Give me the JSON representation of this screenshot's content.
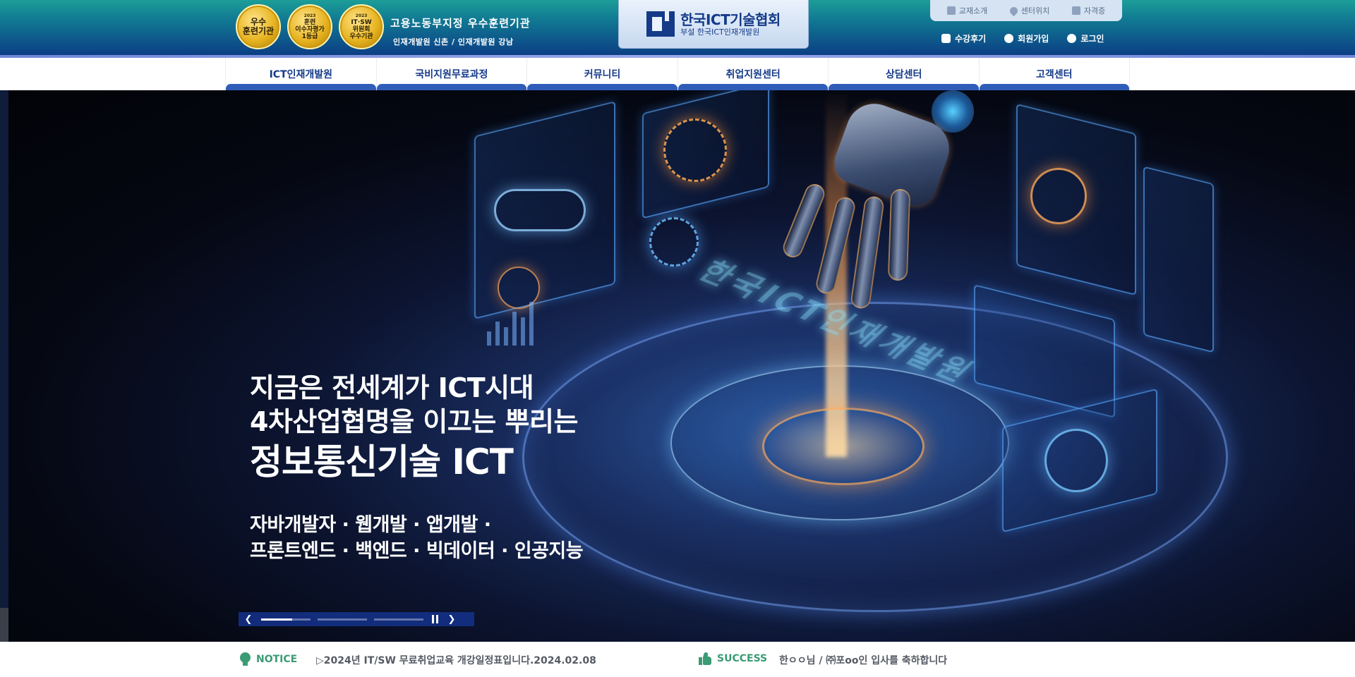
{
  "header": {
    "badges": [
      {
        "year": "",
        "text": "우수\n훈련기관"
      },
      {
        "year": "2023",
        "text": "훈련\n이수자평가\n1등급"
      },
      {
        "year": "2023",
        "text": "IT·SW\n위원회\n우수기관"
      }
    ],
    "org_title": "고용노동부지정 우수훈련기관",
    "org_sub": "인재개발원 신촌 / 인재개발원 강남",
    "logo_name": "한국ICT기술협회",
    "logo_sub": "부설 한국ICT인재개발원",
    "util_links": [
      {
        "label": "교재소개",
        "icon": "book-icon"
      },
      {
        "label": "센터위치",
        "icon": "location-pin-icon"
      },
      {
        "label": "자격증",
        "icon": "certificate-icon"
      }
    ],
    "user_links": [
      {
        "label": "수강후기",
        "icon": "review-icon"
      },
      {
        "label": "회원가입",
        "icon": "signup-icon"
      },
      {
        "label": "로그인",
        "icon": "login-icon"
      }
    ]
  },
  "nav": {
    "items": [
      "ICT인재개발원",
      "국비지원무료과정",
      "커뮤니티",
      "취업지원센터",
      "상담센터",
      "고객센터"
    ]
  },
  "hero": {
    "headline_1": "지금은 전세계가 ICT시대",
    "headline_2": "4차산업협명을 이끄는 뿌리는",
    "headline_3": "정보통신기술 ICT",
    "sub_1": "자바개발자 · 웹개발 · 앱개발 ·",
    "sub_2": "프론트엔드 · 백엔드 · 빅데이터 · 인공지능",
    "holo_text": "한국ICT인재개발원",
    "slider": {
      "total_slides": 3,
      "active_slide": 1,
      "progress": 0.63,
      "prev_icon": "chevron-left-icon",
      "next_icon": "chevron-right-icon",
      "pause_icon": "pause-icon"
    }
  },
  "notices": {
    "notice_label": "NOTICE",
    "notice_text": "▷2024년 IT/SW 무료취업교육 개강일정표입니다.2024.02.08",
    "success_label": "SUCCESS",
    "success_text": "한ㅇㅇ님 / ㈜포oo인 입사를 축하합니다"
  },
  "colors": {
    "brand_navy": "#143a88",
    "header_teal": "#1c9e98",
    "nav_tab": "#2f5cb8",
    "accent_green": "#3a9b74"
  }
}
